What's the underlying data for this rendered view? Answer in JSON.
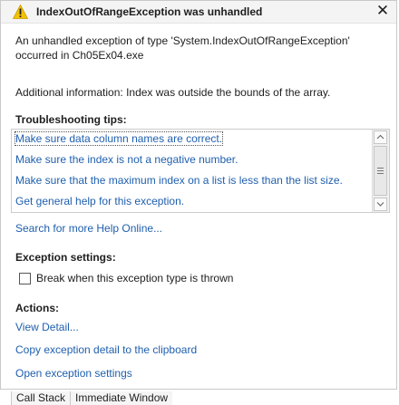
{
  "dialog": {
    "title": "IndexOutOfRangeException was unhandled",
    "close_glyph": "✕",
    "message": "An unhandled exception of type 'System.IndexOutOfRangeException' occurred in Ch05Ex04.exe",
    "additional_info": "Additional information: Index was outside the bounds of the array.",
    "warning_icon": "warning-triangle-icon",
    "warning_color": "#f2c200"
  },
  "troubleshooting": {
    "heading": "Troubleshooting tips:",
    "tips": [
      "Make sure data column names are correct.",
      "Make sure the index is not a negative number.",
      "Make sure that the maximum index on a list is less than the list size.",
      "Get general help for this exception."
    ],
    "search_link": "Search for more Help Online..."
  },
  "exception_settings": {
    "heading": "Exception settings:",
    "checkbox_label": "Break when this exception type is thrown",
    "checked": false
  },
  "actions": {
    "heading": "Actions:",
    "items": [
      "View Detail...",
      "Copy exception detail to the clipboard",
      "Open exception settings"
    ]
  },
  "bottom_tabs": [
    "Call Stack",
    "Immediate Window"
  ],
  "colors": {
    "link": "#1f5fae",
    "title_bar": "#f4f4f4"
  }
}
